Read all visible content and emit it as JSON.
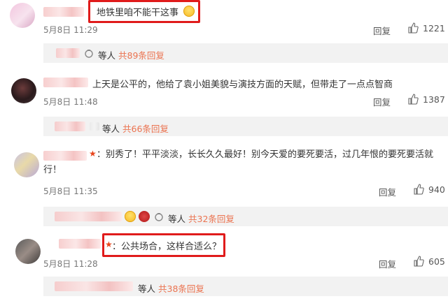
{
  "comments": [
    {
      "text": "地铁里咱不能干这事",
      "date": "5月8日 11:29",
      "reply_label": "回复",
      "likes": "1221",
      "sub_suffix": "等人",
      "sub_count": "共89条回复"
    },
    {
      "text": "上天是公平的，他给了袁小姐美貌与演技方面的天赋，但带走了一点点智商",
      "date": "5月8日 11:48",
      "reply_label": "回复",
      "likes": "1387",
      "sub_suffix": "等人",
      "sub_count": "共66条回复"
    },
    {
      "text": "：别秀了！平平淡淡，长长久久最好！别今天爱的要死要活，过几年恨的要死要活就行！",
      "date": "5月8日 11:35",
      "reply_label": "回复",
      "likes": "940",
      "sub_suffix": "等人",
      "sub_count": "共32条回复"
    },
    {
      "text": "：公共场合，这样合适么？",
      "date": "5月8日 11:28",
      "reply_label": "回复",
      "likes": "605",
      "sub_suffix": "等人",
      "sub_count": "共38条回复"
    }
  ],
  "colors": {
    "highlight": "#e01b1b",
    "link": "#eb7350",
    "subbar_bg": "#f2f2f2"
  },
  "icons": [
    "thumbs-up-icon",
    "badge-ring-icon",
    "grin-emoji-icon",
    "star-badge-icon"
  ]
}
